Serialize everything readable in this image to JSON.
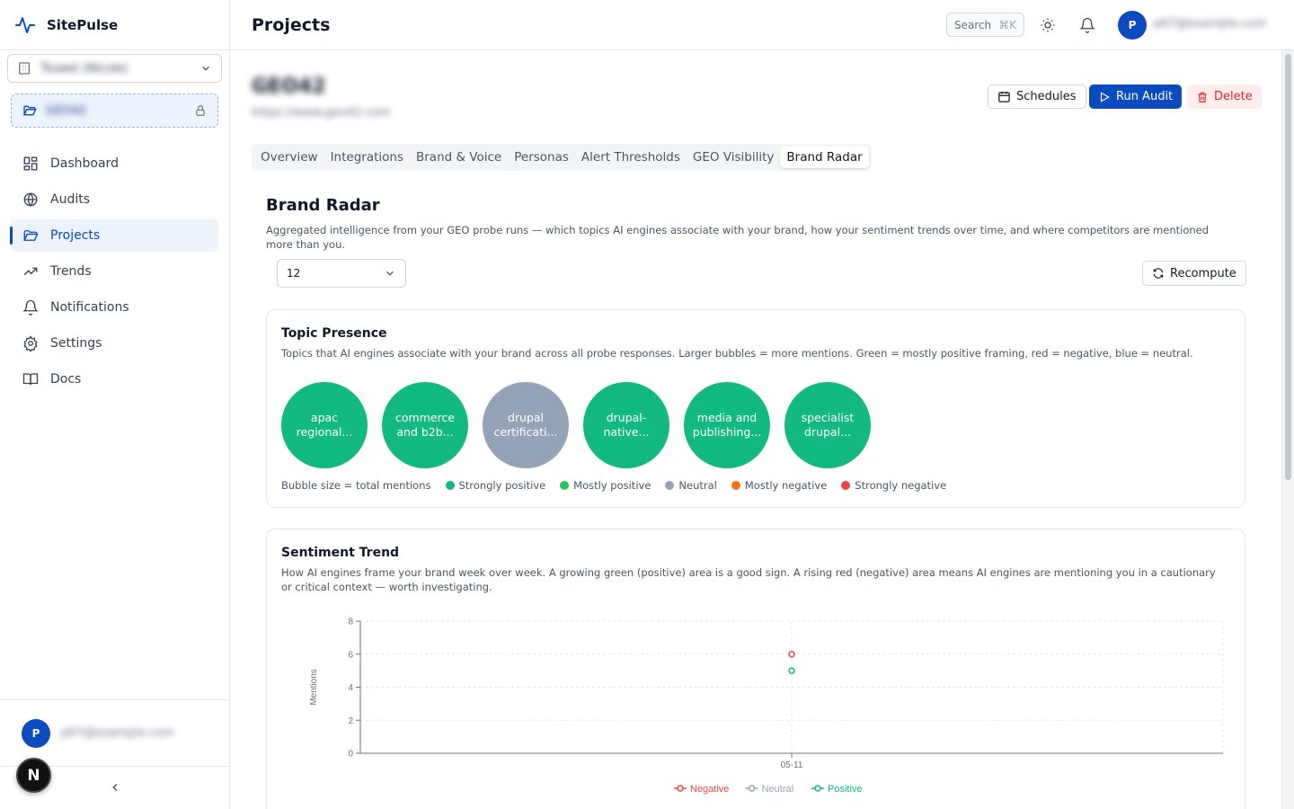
{
  "app": {
    "name": "SitePulse"
  },
  "sidebar": {
    "org_name": "Tsuwei (Nicole)",
    "project_name": "GEO42",
    "items": [
      {
        "label": "Dashboard",
        "icon": "dashboard-icon",
        "active": false
      },
      {
        "label": "Audits",
        "icon": "globe-icon",
        "active": false
      },
      {
        "label": "Projects",
        "icon": "folder-icon",
        "active": true
      },
      {
        "label": "Trends",
        "icon": "trending-icon",
        "active": false
      },
      {
        "label": "Notifications",
        "icon": "bell-icon",
        "active": false
      },
      {
        "label": "Settings",
        "icon": "gear-icon",
        "active": false
      },
      {
        "label": "Docs",
        "icon": "book-icon",
        "active": false
      }
    ],
    "user_initial": "P",
    "user_email": "p67@example.com",
    "next_badge": "N"
  },
  "header": {
    "title": "Projects",
    "search_label": "Search",
    "search_shortcut": "⌘K",
    "user_initial": "P",
    "user_email": "p67@example.com"
  },
  "project": {
    "name": "GEO42",
    "url": "https://www.geo42.com",
    "buttons": {
      "schedules": "Schedules",
      "run_audit": "Run Audit",
      "delete": "Delete"
    }
  },
  "tabs": [
    {
      "label": "Overview",
      "active": false
    },
    {
      "label": "Integrations",
      "active": false
    },
    {
      "label": "Brand & Voice",
      "active": false
    },
    {
      "label": "Personas",
      "active": false
    },
    {
      "label": "Alert Thresholds",
      "active": false
    },
    {
      "label": "GEO Visibility",
      "active": false
    },
    {
      "label": "Brand Radar",
      "active": true
    }
  ],
  "brand_radar": {
    "title": "Brand Radar",
    "description": "Aggregated intelligence from your GEO probe runs — which topics AI engines associate with your brand, how your sentiment trends over time, and where competitors are mentioned more than you.",
    "period_value": "12",
    "recompute_label": "Recompute"
  },
  "topic_presence": {
    "title": "Topic Presence",
    "description": "Topics that AI engines associate with your brand across all probe responses. Larger bubbles = more mentions. Green = mostly positive framing, red = negative, blue = neutral.",
    "bubbles": [
      {
        "label": "apac regional...",
        "sentiment": "positive"
      },
      {
        "label": "commerce and b2b...",
        "sentiment": "positive"
      },
      {
        "label": "drupal certificati...",
        "sentiment": "neutral"
      },
      {
        "label": "drupal-native...",
        "sentiment": "positive"
      },
      {
        "label": "media and publishing...",
        "sentiment": "positive"
      },
      {
        "label": "specialist drupal...",
        "sentiment": "positive"
      }
    ],
    "legend_caption": "Bubble size = total mentions",
    "legend": [
      {
        "label": "Strongly positive",
        "color": "#10b981"
      },
      {
        "label": "Mostly positive",
        "color": "#22c55e"
      },
      {
        "label": "Neutral",
        "color": "#94a3b8"
      },
      {
        "label": "Mostly negative",
        "color": "#f97316"
      },
      {
        "label": "Strongly negative",
        "color": "#ef4444"
      }
    ],
    "colors": {
      "positive": "#12b981",
      "neutral": "#94a3b8"
    }
  },
  "sentiment_trend": {
    "title": "Sentiment Trend",
    "description": "How AI engines frame your brand week over week. A growing green (positive) area is a good sign. A rising red (negative) area means AI engines are mentioning you in a cautionary or critical context — worth investigating."
  },
  "chart_data": {
    "type": "line",
    "x": [
      "05-11"
    ],
    "ylabel": "Mentions",
    "xlabel": "",
    "ylim": [
      0,
      8
    ],
    "yticks": [
      0,
      2,
      4,
      6,
      8
    ],
    "grid": true,
    "legend_position": "bottom",
    "series": [
      {
        "name": "Negative",
        "values": [
          6
        ],
        "color": "#ef4444"
      },
      {
        "name": "Neutral",
        "values": [
          0
        ],
        "color": "#94a3b8"
      },
      {
        "name": "Positive",
        "values": [
          5
        ],
        "color": "#10b981"
      }
    ]
  }
}
